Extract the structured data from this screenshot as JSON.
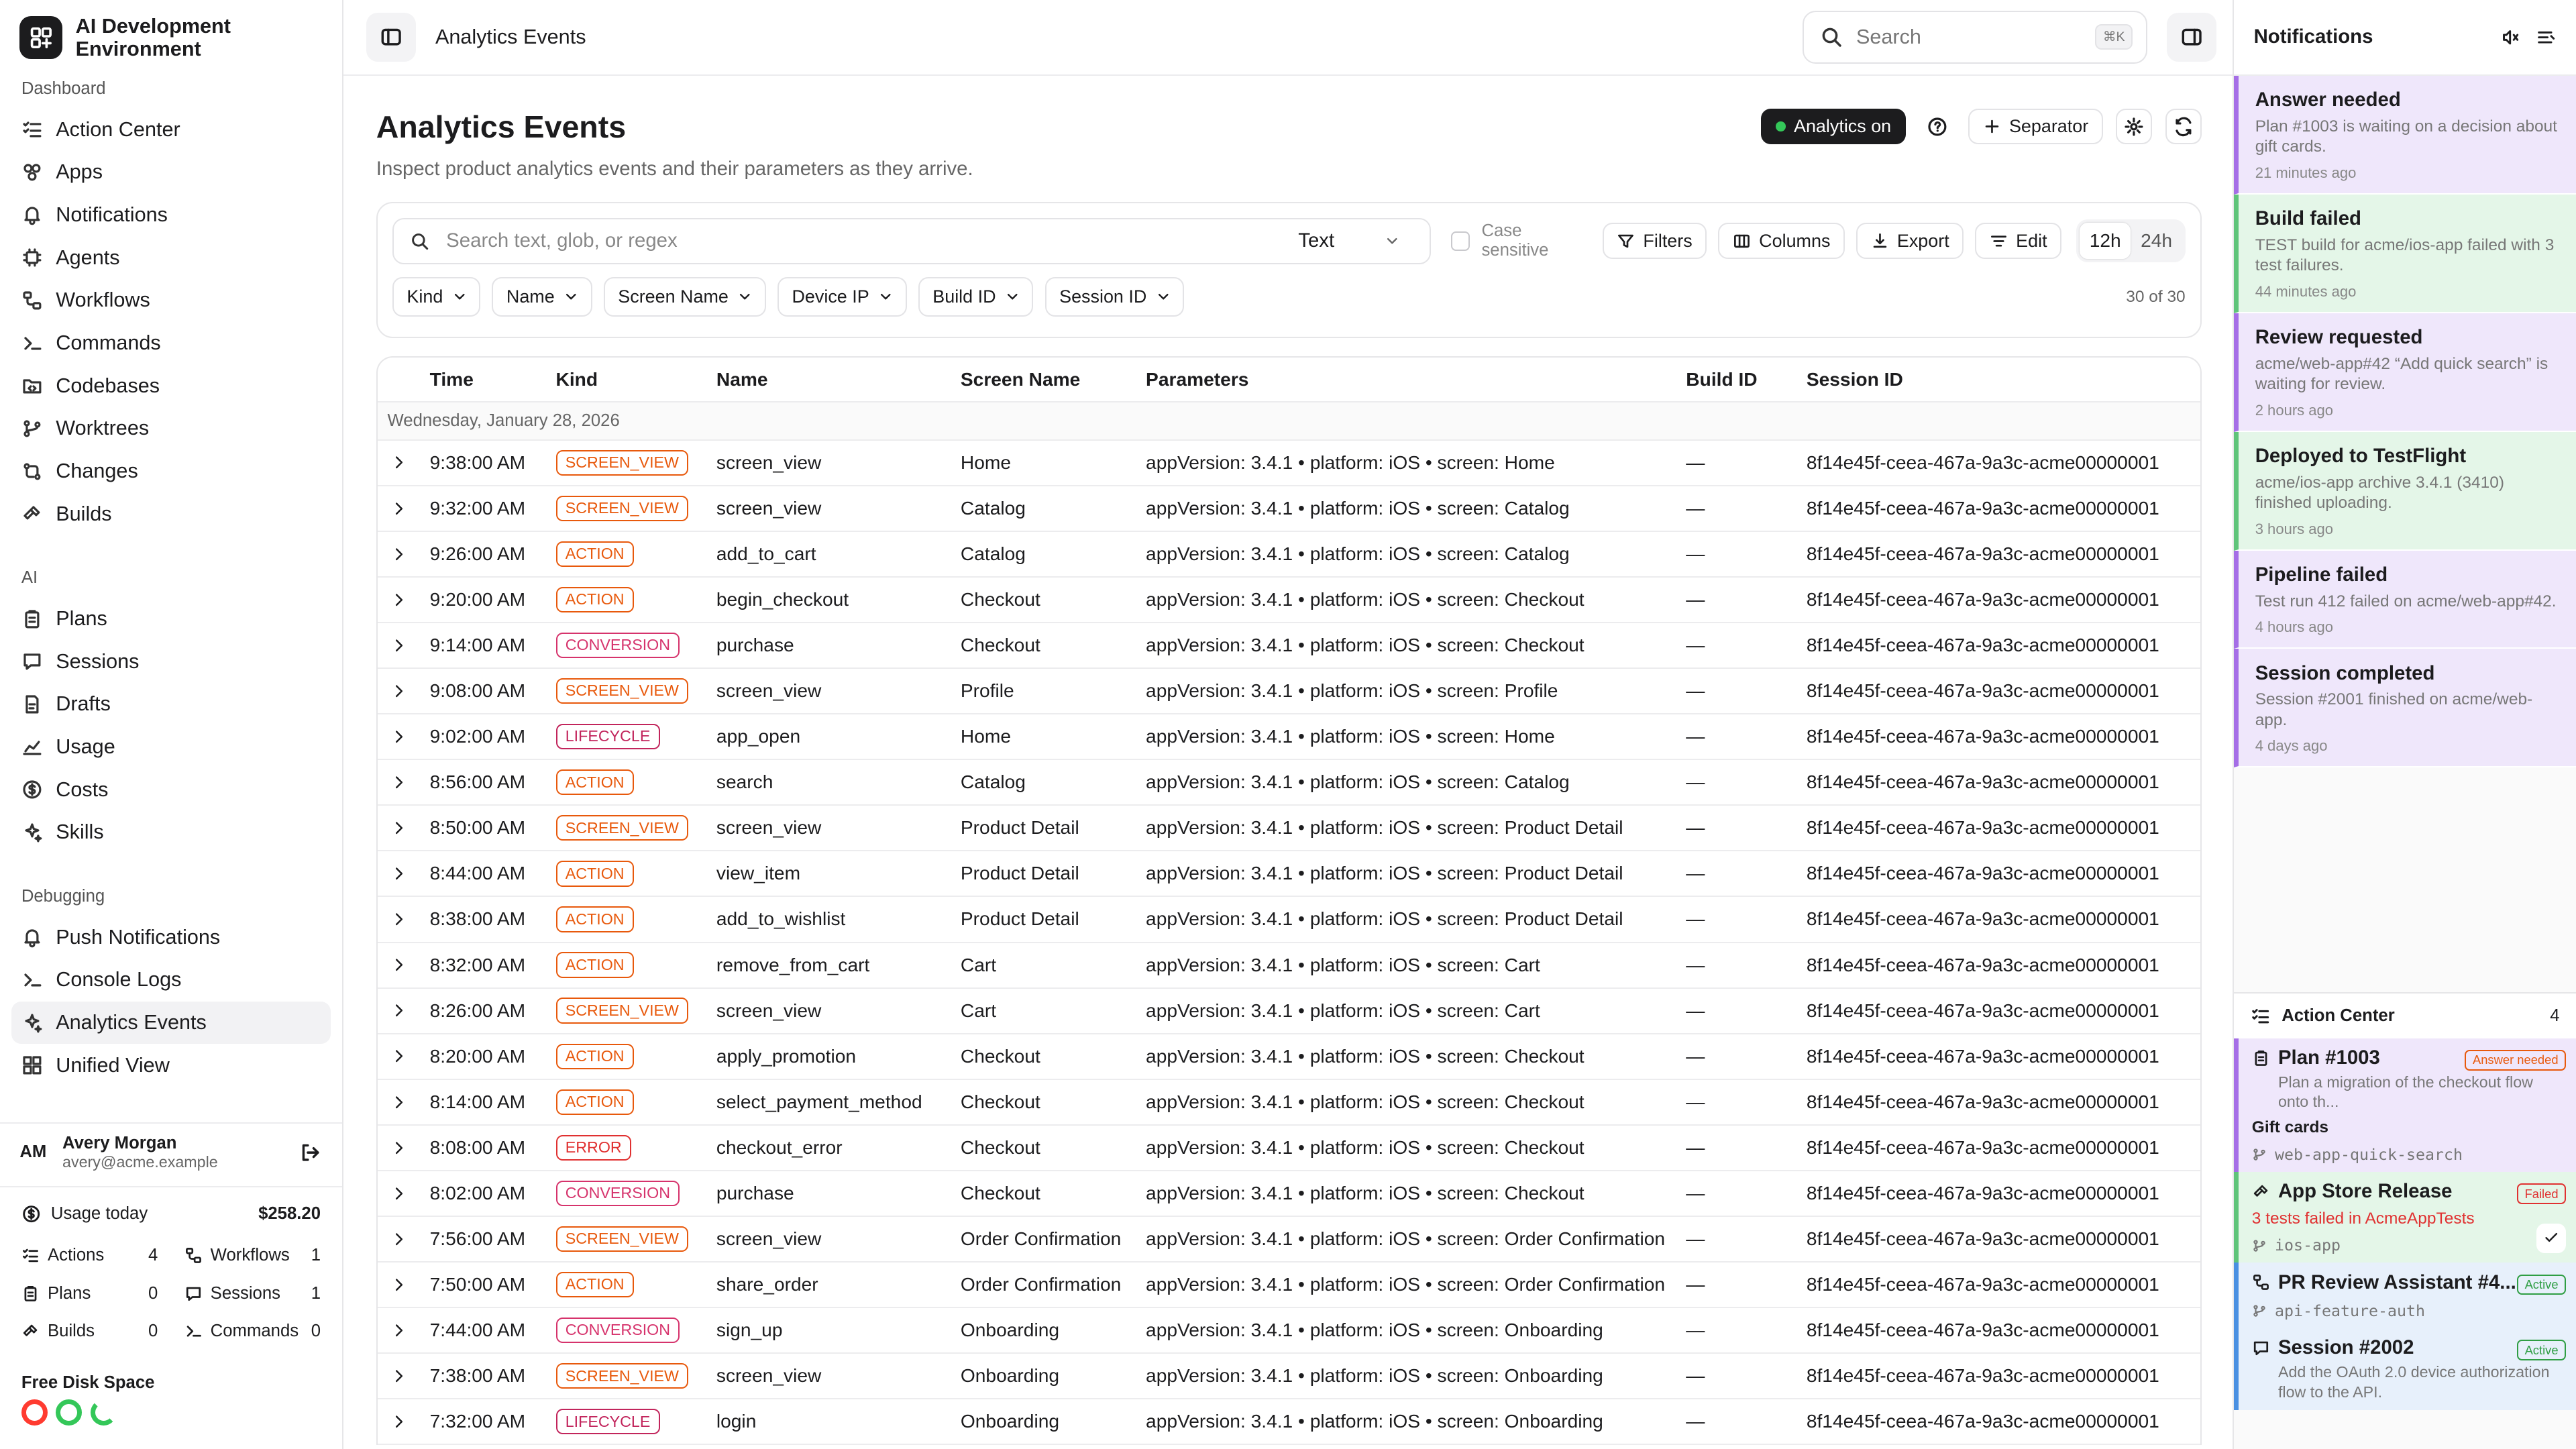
{
  "app": {
    "name": "AI Development Environment"
  },
  "sidebar": {
    "sections": [
      {
        "label": "Dashboard",
        "items": [
          {
            "label": "Action Center",
            "icon": "list-check-icon"
          },
          {
            "label": "Apps",
            "icon": "apps-icon"
          },
          {
            "label": "Notifications",
            "icon": "bell-icon"
          },
          {
            "label": "Agents",
            "icon": "cpu-icon"
          },
          {
            "label": "Workflows",
            "icon": "workflow-icon"
          },
          {
            "label": "Commands",
            "icon": "terminal-icon"
          },
          {
            "label": "Codebases",
            "icon": "folder-code-icon"
          },
          {
            "label": "Worktrees",
            "icon": "git-branch-icon"
          },
          {
            "label": "Changes",
            "icon": "git-compare-icon"
          },
          {
            "label": "Builds",
            "icon": "hammer-icon"
          }
        ]
      },
      {
        "label": "AI",
        "items": [
          {
            "label": "Plans",
            "icon": "clipboard-icon"
          },
          {
            "label": "Sessions",
            "icon": "chat-icon"
          },
          {
            "label": "Drafts",
            "icon": "file-edit-icon"
          },
          {
            "label": "Usage",
            "icon": "chart-icon"
          },
          {
            "label": "Costs",
            "icon": "dollar-icon"
          },
          {
            "label": "Skills",
            "icon": "sparkle-icon"
          }
        ]
      },
      {
        "label": "Debugging",
        "items": [
          {
            "label": "Push Notifications",
            "icon": "bell-icon"
          },
          {
            "label": "Console Logs",
            "icon": "terminal-icon"
          },
          {
            "label": "Analytics Events",
            "icon": "sparkle-icon",
            "active": true
          },
          {
            "label": "Unified View",
            "icon": "grid-icon"
          }
        ]
      }
    ],
    "user": {
      "initials": "AM",
      "name": "Avery Morgan",
      "email": "avery@acme.example"
    },
    "usage": {
      "label": "Usage today",
      "amount": "$258.20",
      "stats": [
        {
          "label": "Actions",
          "value": "4",
          "icon": "list-check-icon"
        },
        {
          "label": "Workflows",
          "value": "1",
          "icon": "workflow-icon"
        },
        {
          "label": "Plans",
          "value": "0",
          "icon": "clipboard-icon"
        },
        {
          "label": "Sessions",
          "value": "1",
          "icon": "chat-icon"
        },
        {
          "label": "Builds",
          "value": "0",
          "icon": "hammer-icon"
        },
        {
          "label": "Commands",
          "value": "0",
          "icon": "terminal-icon"
        }
      ]
    },
    "disk": {
      "label": "Free Disk Space",
      "rings": [
        "#ff3b30",
        "#34c759",
        "#34c759"
      ]
    }
  },
  "topbar": {
    "breadcrumb": "Analytics Events",
    "search_placeholder": "Search",
    "shortcut": "⌘K"
  },
  "page": {
    "title": "Analytics Events",
    "subtitle": "Inspect product analytics events and their parameters as they arrive.",
    "analytics_toggle": "Analytics on",
    "separator_label": "Separator"
  },
  "filters": {
    "search_placeholder": "Search text, glob, or regex",
    "mode": "Text",
    "case_sensitive": "Case sensitive",
    "buttons": [
      "Filters",
      "Columns",
      "Export",
      "Edit"
    ],
    "ranges": [
      "12h",
      "24h"
    ],
    "active_range": "12h",
    "dropdowns": [
      "Kind",
      "Name",
      "Screen Name",
      "Device IP",
      "Build ID",
      "Session ID"
    ],
    "count": "30 of 30"
  },
  "table": {
    "columns": [
      "Time",
      "Kind",
      "Name",
      "Screen Name",
      "Parameters",
      "Build ID",
      "Session ID"
    ],
    "date_group": "Wednesday, January 28, 2026",
    "kind_colors": {
      "SCREEN_VIEW": "#e8590c",
      "ACTION": "#e8590c",
      "CONVERSION": "#d6336c",
      "LIFECYCLE": "#c2255c",
      "ERROR": "#e03131"
    },
    "rows": [
      {
        "time": "9:38:00 AM",
        "kind": "SCREEN_VIEW",
        "name": "screen_view",
        "screen": "Home",
        "params": "appVersion: 3.4.1 • platform: iOS • screen: Home",
        "build": "—",
        "session": "8f14e45f-ceea-467a-9a3c-acme00000001"
      },
      {
        "time": "9:32:00 AM",
        "kind": "SCREEN_VIEW",
        "name": "screen_view",
        "screen": "Catalog",
        "params": "appVersion: 3.4.1 • platform: iOS • screen: Catalog",
        "build": "—",
        "session": "8f14e45f-ceea-467a-9a3c-acme00000001"
      },
      {
        "time": "9:26:00 AM",
        "kind": "ACTION",
        "name": "add_to_cart",
        "screen": "Catalog",
        "params": "appVersion: 3.4.1 • platform: iOS • screen: Catalog",
        "build": "—",
        "session": "8f14e45f-ceea-467a-9a3c-acme00000001"
      },
      {
        "time": "9:20:00 AM",
        "kind": "ACTION",
        "name": "begin_checkout",
        "screen": "Checkout",
        "params": "appVersion: 3.4.1 • platform: iOS • screen: Checkout",
        "build": "—",
        "session": "8f14e45f-ceea-467a-9a3c-acme00000001"
      },
      {
        "time": "9:14:00 AM",
        "kind": "CONVERSION",
        "name": "purchase",
        "screen": "Checkout",
        "params": "appVersion: 3.4.1 • platform: iOS • screen: Checkout",
        "build": "—",
        "session": "8f14e45f-ceea-467a-9a3c-acme00000001"
      },
      {
        "time": "9:08:00 AM",
        "kind": "SCREEN_VIEW",
        "name": "screen_view",
        "screen": "Profile",
        "params": "appVersion: 3.4.1 • platform: iOS • screen: Profile",
        "build": "—",
        "session": "8f14e45f-ceea-467a-9a3c-acme00000001"
      },
      {
        "time": "9:02:00 AM",
        "kind": "LIFECYCLE",
        "name": "app_open",
        "screen": "Home",
        "params": "appVersion: 3.4.1 • platform: iOS • screen: Home",
        "build": "—",
        "session": "8f14e45f-ceea-467a-9a3c-acme00000001"
      },
      {
        "time": "8:56:00 AM",
        "kind": "ACTION",
        "name": "search",
        "screen": "Catalog",
        "params": "appVersion: 3.4.1 • platform: iOS • screen: Catalog",
        "build": "—",
        "session": "8f14e45f-ceea-467a-9a3c-acme00000001"
      },
      {
        "time": "8:50:00 AM",
        "kind": "SCREEN_VIEW",
        "name": "screen_view",
        "screen": "Product Detail",
        "params": "appVersion: 3.4.1 • platform: iOS • screen: Product Detail",
        "build": "—",
        "session": "8f14e45f-ceea-467a-9a3c-acme00000001"
      },
      {
        "time": "8:44:00 AM",
        "kind": "ACTION",
        "name": "view_item",
        "screen": "Product Detail",
        "params": "appVersion: 3.4.1 • platform: iOS • screen: Product Detail",
        "build": "—",
        "session": "8f14e45f-ceea-467a-9a3c-acme00000001"
      },
      {
        "time": "8:38:00 AM",
        "kind": "ACTION",
        "name": "add_to_wishlist",
        "screen": "Product Detail",
        "params": "appVersion: 3.4.1 • platform: iOS • screen: Product Detail",
        "build": "—",
        "session": "8f14e45f-ceea-467a-9a3c-acme00000001"
      },
      {
        "time": "8:32:00 AM",
        "kind": "ACTION",
        "name": "remove_from_cart",
        "screen": "Cart",
        "params": "appVersion: 3.4.1 • platform: iOS • screen: Cart",
        "build": "—",
        "session": "8f14e45f-ceea-467a-9a3c-acme00000001"
      },
      {
        "time": "8:26:00 AM",
        "kind": "SCREEN_VIEW",
        "name": "screen_view",
        "screen": "Cart",
        "params": "appVersion: 3.4.1 • platform: iOS • screen: Cart",
        "build": "—",
        "session": "8f14e45f-ceea-467a-9a3c-acme00000001"
      },
      {
        "time": "8:20:00 AM",
        "kind": "ACTION",
        "name": "apply_promotion",
        "screen": "Checkout",
        "params": "appVersion: 3.4.1 • platform: iOS • screen: Checkout",
        "build": "—",
        "session": "8f14e45f-ceea-467a-9a3c-acme00000001"
      },
      {
        "time": "8:14:00 AM",
        "kind": "ACTION",
        "name": "select_payment_method",
        "screen": "Checkout",
        "params": "appVersion: 3.4.1 • platform: iOS • screen: Checkout",
        "build": "—",
        "session": "8f14e45f-ceea-467a-9a3c-acme00000001"
      },
      {
        "time": "8:08:00 AM",
        "kind": "ERROR",
        "name": "checkout_error",
        "screen": "Checkout",
        "params": "appVersion: 3.4.1 • platform: iOS • screen: Checkout",
        "build": "—",
        "session": "8f14e45f-ceea-467a-9a3c-acme00000001"
      },
      {
        "time": "8:02:00 AM",
        "kind": "CONVERSION",
        "name": "purchase",
        "screen": "Checkout",
        "params": "appVersion: 3.4.1 • platform: iOS • screen: Checkout",
        "build": "—",
        "session": "8f14e45f-ceea-467a-9a3c-acme00000001"
      },
      {
        "time": "7:56:00 AM",
        "kind": "SCREEN_VIEW",
        "name": "screen_view",
        "screen": "Order Confirmation",
        "params": "appVersion: 3.4.1 • platform: iOS • screen: Order Confirmation",
        "build": "—",
        "session": "8f14e45f-ceea-467a-9a3c-acme00000001"
      },
      {
        "time": "7:50:00 AM",
        "kind": "ACTION",
        "name": "share_order",
        "screen": "Order Confirmation",
        "params": "appVersion: 3.4.1 • platform: iOS • screen: Order Confirmation",
        "build": "—",
        "session": "8f14e45f-ceea-467a-9a3c-acme00000001"
      },
      {
        "time": "7:44:00 AM",
        "kind": "CONVERSION",
        "name": "sign_up",
        "screen": "Onboarding",
        "params": "appVersion: 3.4.1 • platform: iOS • screen: Onboarding",
        "build": "—",
        "session": "8f14e45f-ceea-467a-9a3c-acme00000001"
      },
      {
        "time": "7:38:00 AM",
        "kind": "SCREEN_VIEW",
        "name": "screen_view",
        "screen": "Onboarding",
        "params": "appVersion: 3.4.1 • platform: iOS • screen: Onboarding",
        "build": "—",
        "session": "8f14e45f-ceea-467a-9a3c-acme00000001"
      },
      {
        "time": "7:32:00 AM",
        "kind": "LIFECYCLE",
        "name": "login",
        "screen": "Onboarding",
        "params": "appVersion: 3.4.1 • platform: iOS • screen: Onboarding",
        "build": "—",
        "session": "8f14e45f-ceea-467a-9a3c-acme00000001"
      }
    ]
  },
  "notifications": {
    "title": "Notifications",
    "items": [
      {
        "title": "Answer needed",
        "body": "Plan #1003 is waiting on a decision about gift cards.",
        "time": "21 minutes ago",
        "bg": "#efe7fb",
        "accent": "#a56ee6"
      },
      {
        "title": "Build failed",
        "body": "TEST build for acme/ios-app failed with 3 test failures.",
        "time": "44 minutes ago",
        "bg": "#e4f6e8",
        "accent": "#5fc47a"
      },
      {
        "title": "Review requested",
        "body": "acme/web-app#42 “Add quick search” is waiting for review.",
        "time": "2 hours ago",
        "bg": "#efe7fb",
        "accent": "#a56ee6"
      },
      {
        "title": "Deployed to TestFlight",
        "body": "acme/ios-app archive 3.4.1 (3410) finished uploading.",
        "time": "3 hours ago",
        "bg": "#e4f6e8",
        "accent": "#5fc47a"
      },
      {
        "title": "Pipeline failed",
        "body": "Test run 412 failed on acme/web-app#42.",
        "time": "4 hours ago",
        "bg": "#efe7fb",
        "accent": "#a56ee6"
      },
      {
        "title": "Session completed",
        "body": "Session #2001 finished on acme/web-app.",
        "time": "4 days ago",
        "bg": "#efe7fb",
        "accent": "#a56ee6"
      }
    ]
  },
  "action_center": {
    "title": "Action Center",
    "count": "4",
    "items": [
      {
        "title": "Plan #1003",
        "tag": "Answer needed",
        "tag_color": "#e8590c",
        "sub": "Plan a migration of the checkout flow onto th...",
        "line": "Gift cards",
        "branch": "web-app-quick-search",
        "bg": "#efe7fb",
        "accent": "#a56ee6",
        "icon": "clipboard-icon"
      },
      {
        "title": "App Store Release",
        "tag": "Failed",
        "tag_color": "#e03131",
        "sub": "",
        "line": "3 tests failed in AcmeAppTests",
        "branch": "ios-app",
        "bg": "#e4f6e8",
        "accent": "#5fc47a",
        "icon": "hammer-icon"
      },
      {
        "title": "PR Review Assistant #4...",
        "tag": "Active",
        "tag_color": "#2f9e44",
        "sub": "",
        "line": "",
        "branch": "api-feature-auth",
        "bg": "#e7f0fb",
        "accent": "#4a90e2",
        "icon": "workflow-icon"
      },
      {
        "title": "Session #2002",
        "tag": "Active",
        "tag_color": "#2f9e44",
        "sub": "Add the OAuth 2.0 device authorization flow to the API.",
        "line": "",
        "branch": "",
        "bg": "#e7f0fb",
        "accent": "#4a90e2",
        "icon": "chat-icon"
      }
    ]
  }
}
